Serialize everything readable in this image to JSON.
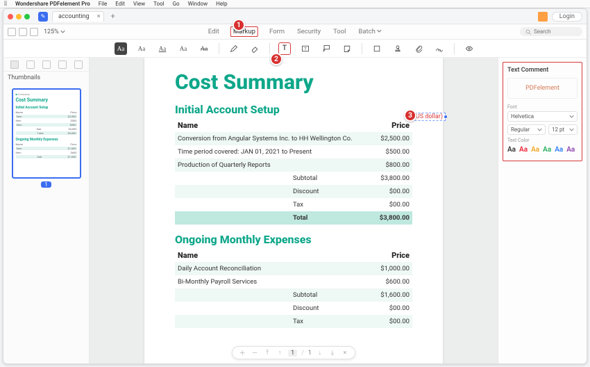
{
  "menubar": {
    "app": "Wondershare PDFelement Pro",
    "items": [
      "File",
      "Edit",
      "View",
      "Tool",
      "Go",
      "Window",
      "Help"
    ]
  },
  "tabrow": {
    "doc_name": "accounting",
    "login": "Login",
    "plus": "+"
  },
  "toolrow": {
    "zoom": "125%",
    "tabs": {
      "edit": "Edit",
      "markup": "Markup",
      "form": "Form",
      "security": "Security",
      "tool": "Tool",
      "batch": "Batch"
    },
    "search_placeholder": "Search"
  },
  "iconrow": {
    "aa_hl": "Aa",
    "aa_small": "Aa",
    "aa_u": "Aa",
    "aa_sm2": "Aa",
    "aa_s": "Aa",
    "pencil": "pencil",
    "eraser": "eraser",
    "text_t": "T",
    "textbox": "T",
    "callout": "callout",
    "note": "note",
    "rect": "rect",
    "stamp": "stamp",
    "attach": "attach",
    "sign": "sign",
    "eye": "eye"
  },
  "left": {
    "title": "Thumbnails",
    "page_badge": "1",
    "thumb": {
      "title": "Cost Summary",
      "s1": "Initial Account Setup",
      "s2": "Ongoing Monthly Expenses"
    }
  },
  "doc": {
    "h1": "Cost Summary",
    "section1": {
      "title": "Initial Account Setup",
      "name_h": "Name",
      "price_h": "Price",
      "rows": [
        {
          "name": "Conversion from Angular Systems Inc. to HH Wellington Co.",
          "price": "$2,500.00"
        },
        {
          "name": "Time period covered: JAN 01, 2021 to Present",
          "price": "$500.00"
        },
        {
          "name": "Production of Quarterly Reports",
          "price": "$800.00"
        }
      ],
      "subtotal_l": "Subtotal",
      "subtotal_v": "$3,800.00",
      "discount_l": "Discount",
      "discount_v": "$00.00",
      "tax_l": "Tax",
      "tax_v": "$00.00",
      "total_l": "Total",
      "total_v": "$3,800.00",
      "comment": "(US dollar)"
    },
    "section2": {
      "title": "Ongoing Monthly Expenses",
      "name_h": "Name",
      "price_h": "Price",
      "rows": [
        {
          "name": "Daily Account Reconciliation",
          "price": "$1,000.00"
        },
        {
          "name": "Bi-Monthly Payroll Services",
          "price": "$600.00"
        }
      ],
      "subtotal_l": "Subtotal",
      "subtotal_v": "$1,600.00",
      "discount_l": "Discount",
      "discount_v": "$00.00",
      "tax_l": "Tax",
      "tax_v": "$00.00"
    }
  },
  "pagetool": {
    "cur": "1",
    "sep": "/",
    "total": "1"
  },
  "inspector": {
    "title": "Text Comment",
    "preview": "PDFelement",
    "font_label": "Font",
    "font_family": "Helvetica",
    "font_weight": "Regular",
    "font_size": "12 pt",
    "color_label": "Text Color",
    "sw": "Aa"
  },
  "badges": {
    "b1": "1",
    "b2": "2",
    "b3": "3"
  }
}
